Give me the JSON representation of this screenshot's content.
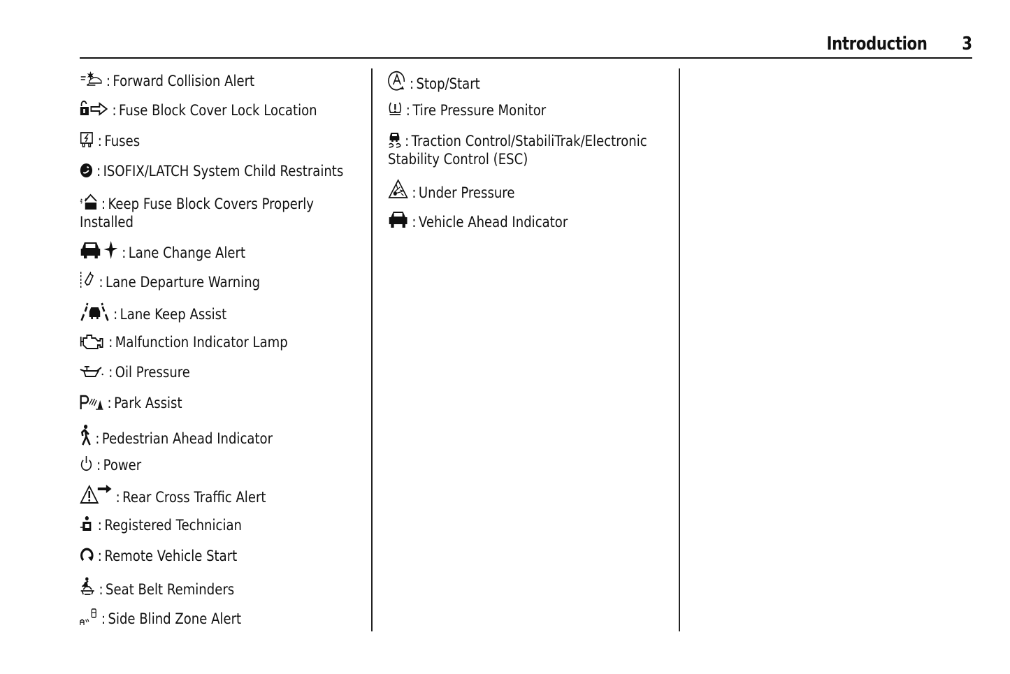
{
  "header": {
    "title": "Introduction",
    "page_number": "3"
  },
  "separator": ":",
  "columns": [
    {
      "entries": [
        {
          "icon": "forward-collision-alert-icon",
          "label": "Forward Collision Alert"
        },
        {
          "icon": "fuse-block-cover-lock-icon",
          "label": "Fuse Block Cover Lock Location"
        },
        {
          "icon": "fuses-icon",
          "label": "Fuses"
        },
        {
          "icon": "isofix-latch-icon",
          "label": "ISOFIX/LATCH System Child Restraints"
        },
        {
          "icon": "keep-fuse-covers-installed-icon",
          "label": "Keep Fuse Block Covers Properly Installed"
        },
        {
          "icon": "lane-change-alert-icon",
          "label": "Lane Change Alert"
        },
        {
          "icon": "lane-departure-warning-icon",
          "label": "Lane Departure Warning"
        },
        {
          "icon": "lane-keep-assist-icon",
          "label": "Lane Keep Assist"
        },
        {
          "icon": "malfunction-indicator-lamp-icon",
          "label": "Malfunction Indicator Lamp"
        },
        {
          "icon": "oil-pressure-icon",
          "label": "Oil Pressure"
        },
        {
          "icon": "park-assist-icon",
          "label": "Park Assist"
        },
        {
          "icon": "pedestrian-ahead-icon",
          "label": "Pedestrian Ahead Indicator"
        },
        {
          "icon": "power-icon",
          "label": "Power"
        },
        {
          "icon": "rear-cross-traffic-alert-icon",
          "label": "Rear Cross Traffic Alert"
        },
        {
          "icon": "registered-technician-icon",
          "label": "Registered Technician"
        },
        {
          "icon": "remote-vehicle-start-icon",
          "label": "Remote Vehicle Start"
        },
        {
          "icon": "seat-belt-reminder-icon",
          "label": "Seat Belt Reminders"
        },
        {
          "icon": "side-blind-zone-alert-icon",
          "label": "Side Blind Zone Alert"
        }
      ]
    },
    {
      "entries": [
        {
          "icon": "stop-start-icon",
          "label": "Stop/Start"
        },
        {
          "icon": "tire-pressure-monitor-icon",
          "label": "Tire Pressure Monitor"
        },
        {
          "icon": "traction-control-icon",
          "label": "Traction Control/StabiliTrak/Electronic Stability Control (ESC)"
        },
        {
          "icon": "under-pressure-icon",
          "label": "Under Pressure"
        },
        {
          "icon": "vehicle-ahead-icon",
          "label": "Vehicle Ahead Indicator"
        }
      ]
    }
  ]
}
